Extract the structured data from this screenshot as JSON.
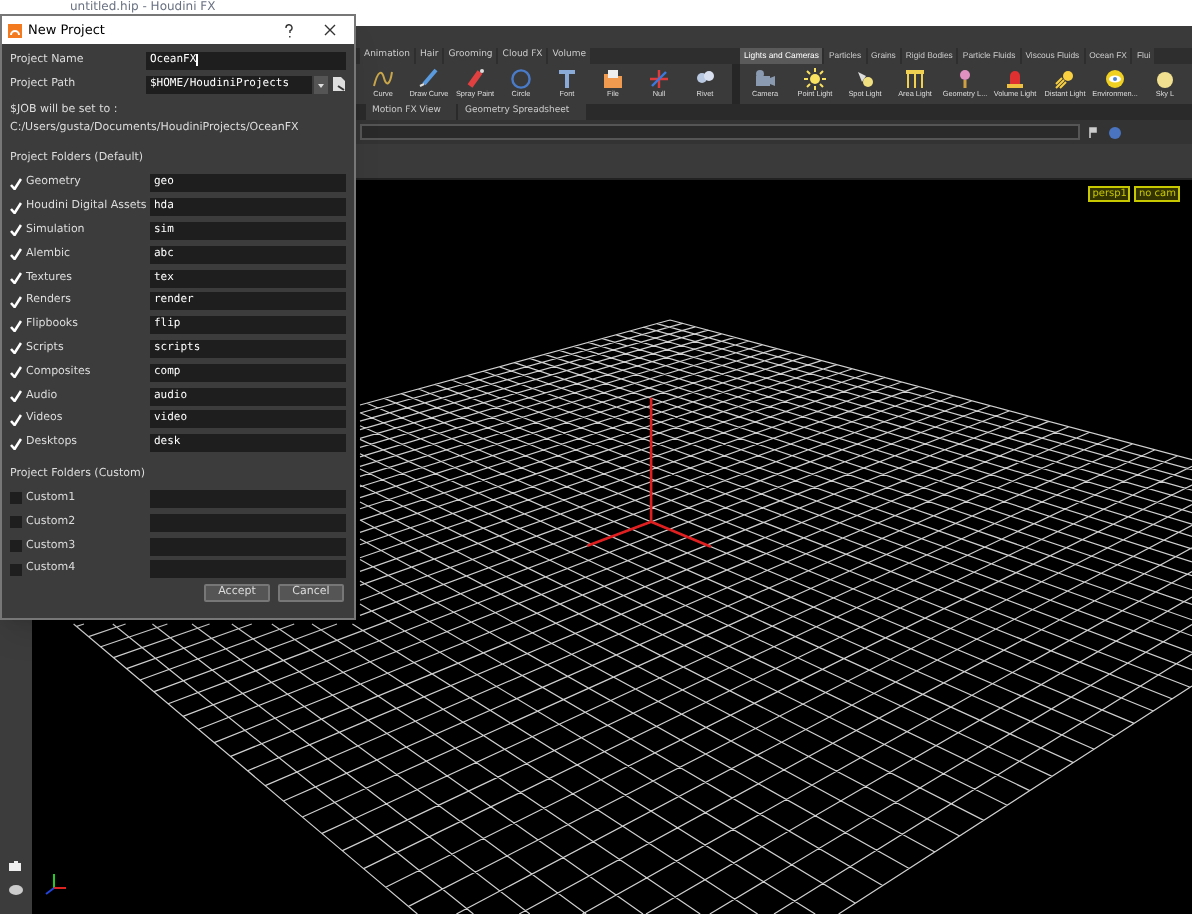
{
  "app": {
    "title": "untitled.hip - Houdini FX",
    "shelf_tabs_left": [
      {
        "label": "Animation"
      },
      {
        "label": "Hair"
      },
      {
        "label": "Grooming"
      },
      {
        "label": "Cloud FX"
      },
      {
        "label": "Volume"
      }
    ],
    "shelf_tabs_right": [
      {
        "label": "Lights and Cameras",
        "selected": true
      },
      {
        "label": "Particles",
        "selected": false
      },
      {
        "label": "Grains",
        "selected": false
      },
      {
        "label": "Rigid Bodies",
        "selected": false
      },
      {
        "label": "Particle Fluids",
        "selected": false
      },
      {
        "label": "Viscous Fluids",
        "selected": false
      },
      {
        "label": "Ocean FX",
        "selected": false
      },
      {
        "label": "Flui",
        "selected": false
      }
    ],
    "shelf_tools_left": [
      "Curve",
      "Draw Curve",
      "Spray Paint",
      "Circle",
      "Font",
      "File",
      "Null",
      "Rivet"
    ],
    "shelf_tools_right": [
      "Camera",
      "Point Light",
      "Spot Light",
      "Area Light",
      "Geometry L...",
      "Volume Light",
      "Distant Light",
      "Environmen...",
      "Sky L"
    ],
    "pane_tabs": [
      "Motion FX View",
      "Geometry Spreadsheet"
    ],
    "viewport": {
      "view_menu": "persp1",
      "camera_menu": "no cam"
    }
  },
  "dialog": {
    "title": "New Project",
    "project_name": {
      "label": "Project Name",
      "value": "OceanFX"
    },
    "project_path": {
      "label": "Project Path",
      "value": "$HOME/HoudiniProjects"
    },
    "job_label": "$JOB will be set to :",
    "job_path": "C:/Users/gusta/Documents/HoudiniProjects/OceanFX",
    "default_heading": "Project Folders (Default)",
    "default_folders": [
      {
        "label": "Geometry",
        "value": "geo",
        "checked": true
      },
      {
        "label": "Houdini Digital Assets",
        "value": "hda",
        "checked": true
      },
      {
        "label": "Simulation",
        "value": "sim",
        "checked": true
      },
      {
        "label": "Alembic",
        "value": "abc",
        "checked": true
      },
      {
        "label": "Textures",
        "value": "tex",
        "checked": true
      },
      {
        "label": "Renders",
        "value": "render",
        "checked": true
      },
      {
        "label": "Flipbooks",
        "value": "flip",
        "checked": true
      },
      {
        "label": "Scripts",
        "value": "scripts",
        "checked": true
      },
      {
        "label": "Composites",
        "value": "comp",
        "checked": true
      },
      {
        "label": "Audio",
        "value": "audio",
        "checked": true
      },
      {
        "label": "Videos",
        "value": "video",
        "checked": true
      },
      {
        "label": "Desktops",
        "value": "desk",
        "checked": true
      }
    ],
    "custom_heading": "Project Folders (Custom)",
    "custom_folders": [
      {
        "label": "Custom1",
        "checked": false
      },
      {
        "label": "Custom2",
        "checked": false
      },
      {
        "label": "Custom3",
        "checked": false
      },
      {
        "label": "Custom4",
        "checked": false
      }
    ],
    "buttons": [
      "Accept",
      "Cancel"
    ]
  }
}
